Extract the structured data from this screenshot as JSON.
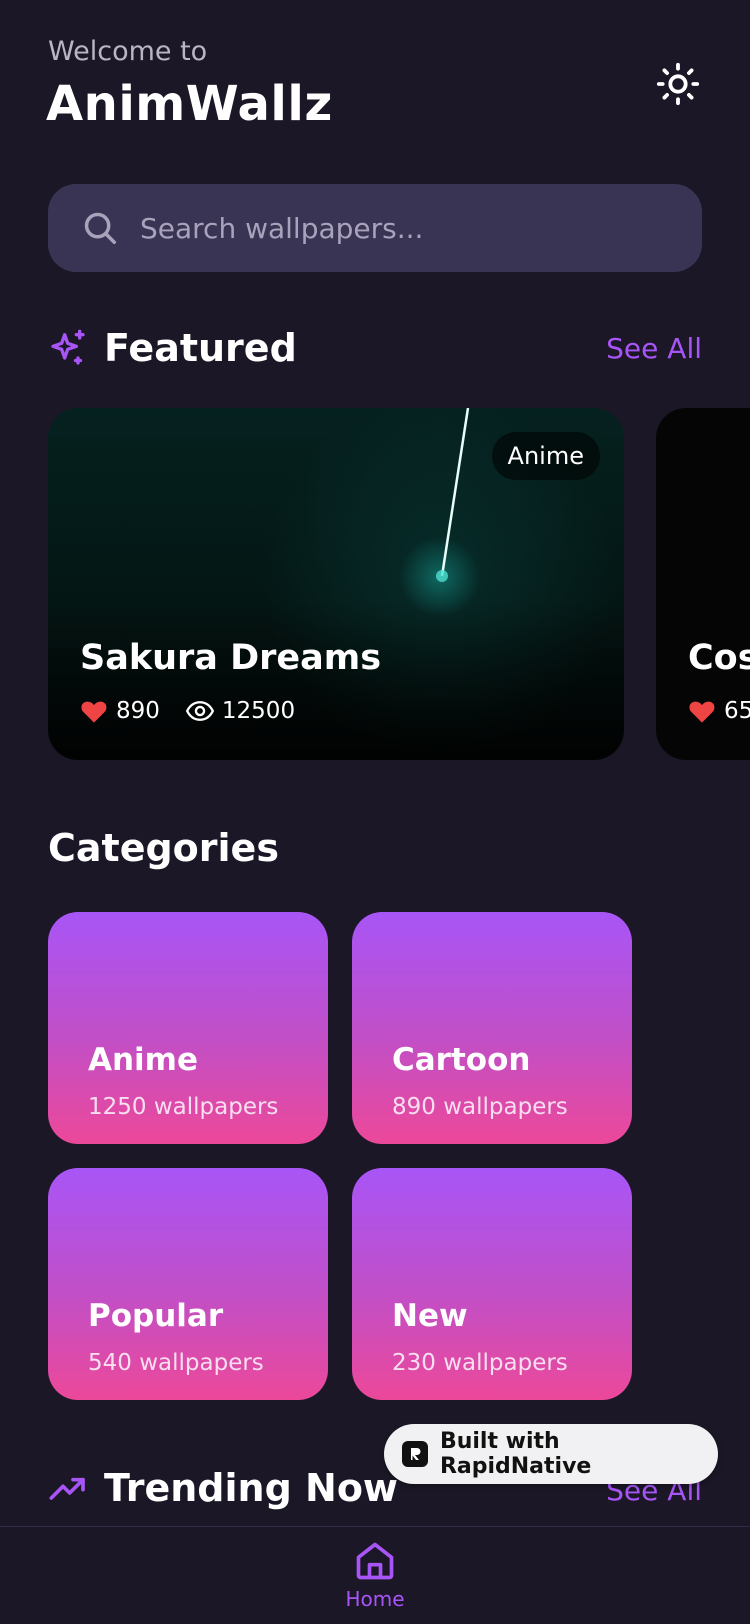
{
  "header": {
    "welcome": "Welcome to",
    "title": "AnimWallz",
    "theme_icon": "sun-icon"
  },
  "search": {
    "placeholder": "Search wallpapers...",
    "value": "",
    "icon": "search-icon"
  },
  "featured": {
    "title": "Featured",
    "icon": "sparkles-icon",
    "see_all": "See All",
    "cards": [
      {
        "title": "Sakura Dreams",
        "badge": "Anime",
        "likes": "890",
        "views": "12500"
      },
      {
        "title": "Cos",
        "likes": "65"
      }
    ]
  },
  "categories": {
    "title": "Categories",
    "items": [
      {
        "name": "Anime",
        "count": "1250 wallpapers"
      },
      {
        "name": "Cartoon",
        "count": "890 wallpapers"
      },
      {
        "name": "Popular",
        "count": "540 wallpapers"
      },
      {
        "name": "New",
        "count": "230 wallpapers"
      }
    ]
  },
  "trending": {
    "title": "Trending Now",
    "icon": "trending-up-icon",
    "see_all": "See All"
  },
  "built_with": {
    "label": "Built with RapidNative"
  },
  "nav": {
    "home_label": "Home",
    "home_icon": "home-icon"
  },
  "colors": {
    "accent": "#a855f7",
    "background": "#1b1726",
    "search_bg": "#3a3454",
    "heart": "#ef4444",
    "category_gradient_top": "#a855f7",
    "category_gradient_bottom": "#ec4899"
  }
}
